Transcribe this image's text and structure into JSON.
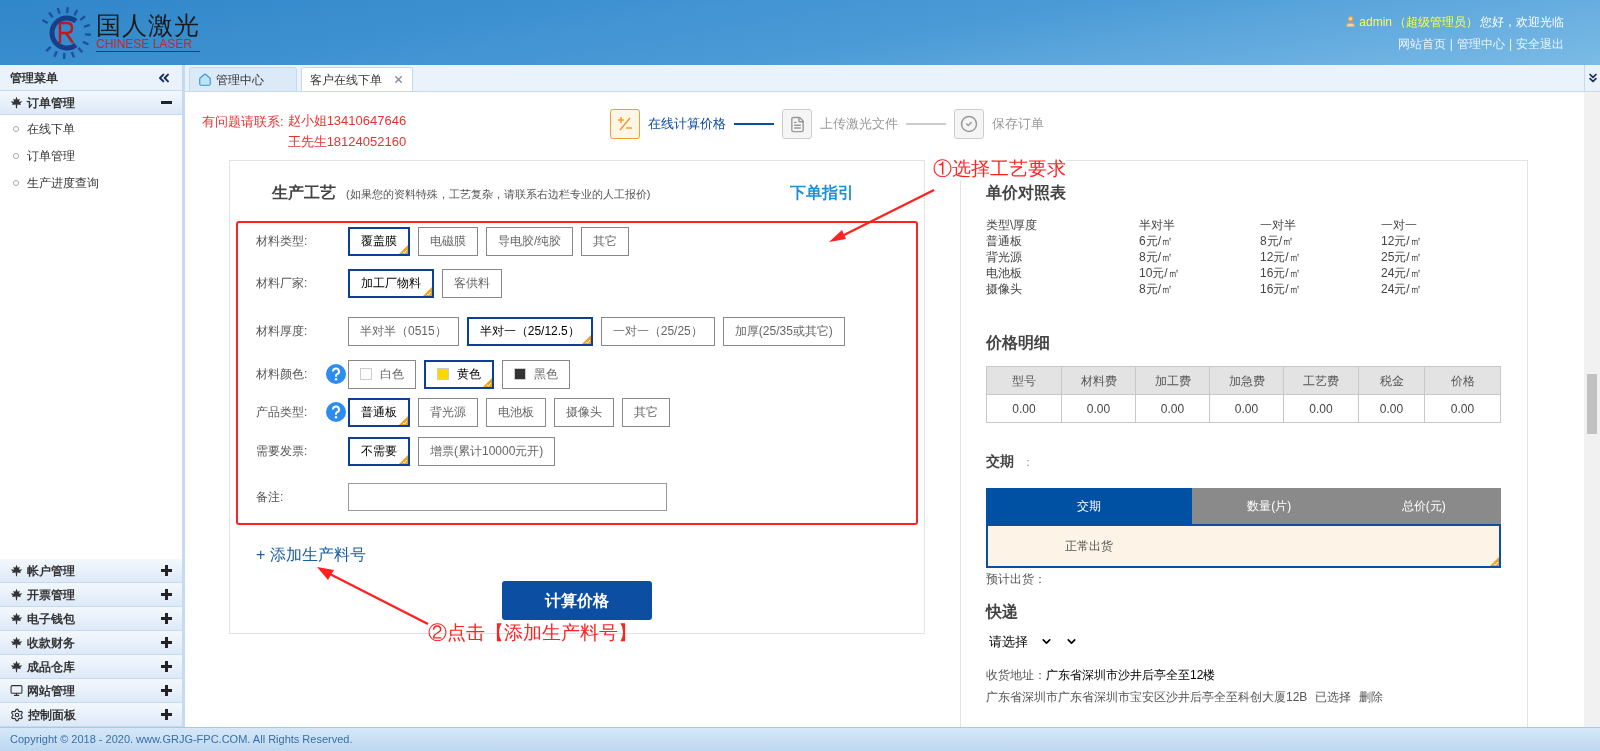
{
  "header": {
    "logo": {
      "name": "国人激光",
      "tagline": "CHINESE LASER"
    },
    "user": {
      "name": "admin",
      "role": "（超级管理员）",
      "greeting": "您好，欢迎光临"
    },
    "links": [
      "网站首页",
      "管理中心",
      "安全退出"
    ],
    "separator": "|"
  },
  "sidebar": {
    "title": "管理菜单",
    "groups": [
      {
        "label": "订单管理",
        "expanded": true,
        "items": [
          "在线下单",
          "订单管理",
          "生产进度查询"
        ]
      },
      {
        "label": "帐户管理",
        "expanded": false
      },
      {
        "label": "开票管理",
        "expanded": false
      },
      {
        "label": "电子钱包",
        "expanded": false
      },
      {
        "label": "收款财务",
        "expanded": false
      },
      {
        "label": "成品仓库",
        "expanded": false
      },
      {
        "label": "网站管理",
        "expanded": false
      },
      {
        "label": "控制面板",
        "expanded": false
      }
    ]
  },
  "tabs": [
    {
      "label": "管理中心",
      "selected": false
    },
    {
      "label": "客户在线下单",
      "selected": true
    }
  ],
  "contact": {
    "label": "有问题请联系:",
    "lines": [
      "赵小姐13410647646",
      "王先生18124052160"
    ]
  },
  "steps": [
    {
      "label": "在线计算价格",
      "active": true
    },
    {
      "label": "上传激光文件",
      "active": false
    },
    {
      "label": "保存订单",
      "active": false
    }
  ],
  "form": {
    "title": "生产工艺",
    "note": "(如果您的资料特殊，工艺复杂，请联系右边栏专业的人工报价)",
    "guide_link": "下单指引",
    "rows": [
      {
        "label": "材料类型:",
        "help": false,
        "options": [
          {
            "label": "覆盖膜",
            "selected": true
          },
          {
            "label": "电磁膜",
            "selected": false
          },
          {
            "label": "导电胶/纯胶",
            "selected": false
          },
          {
            "label": "其它",
            "selected": false
          }
        ]
      },
      {
        "label": "材料厂家:",
        "help": false,
        "options": [
          {
            "label": "加工厂物料",
            "selected": true
          },
          {
            "label": "客供料",
            "selected": false
          }
        ]
      },
      {
        "label": "材料厚度:",
        "help": false,
        "options": [
          {
            "label": "半对半（0515）",
            "selected": false
          },
          {
            "label": "半对一（25/12.5）",
            "selected": true
          },
          {
            "label": "一对一（25/25）",
            "selected": false
          },
          {
            "label": "加厚(25/35或其它)",
            "selected": false
          }
        ]
      },
      {
        "label": "材料颜色:",
        "help": true,
        "options": [
          {
            "label": "白色",
            "selected": false,
            "color": "#ffffff"
          },
          {
            "label": "黄色",
            "selected": true,
            "color": "#ffd700"
          },
          {
            "label": "黑色",
            "selected": false,
            "color": "#333333"
          }
        ]
      },
      {
        "label": "产品类型:",
        "help": true,
        "options": [
          {
            "label": "普通板",
            "selected": true
          },
          {
            "label": "背光源",
            "selected": false
          },
          {
            "label": "电池板",
            "selected": false
          },
          {
            "label": "摄像头",
            "selected": false
          },
          {
            "label": "其它",
            "selected": false
          }
        ]
      },
      {
        "label": "需要发票:",
        "help": false,
        "options": [
          {
            "label": "不需要",
            "selected": true
          },
          {
            "label": "增票(累计10000元开)",
            "selected": false
          }
        ]
      }
    ],
    "remark": {
      "label": "备注:"
    },
    "add_link": "+ 添加生产料号",
    "calc_button": "计算价格"
  },
  "price_table": {
    "title": "单价对照表",
    "columns": [
      "类型\\厚度",
      "半对半",
      "一对半",
      "一对一"
    ],
    "rows": [
      [
        "普通板",
        "6元/㎡",
        "8元/㎡",
        "12元/㎡"
      ],
      [
        "背光源",
        "8元/㎡",
        "12元/㎡",
        "25元/㎡"
      ],
      [
        "电池板",
        "10元/㎡",
        "16元/㎡",
        "24元/㎡"
      ],
      [
        "摄像头",
        "8元/㎡",
        "16元/㎡",
        "24元/㎡"
      ]
    ]
  },
  "price_detail": {
    "title": "价格明细",
    "columns": [
      "型号",
      "材料费",
      "加工费",
      "加急费",
      "工艺费",
      "税金",
      "价格"
    ],
    "values": [
      "0.00",
      "0.00",
      "0.00",
      "0.00",
      "0.00",
      "0.00",
      "0.00"
    ]
  },
  "delivery": {
    "title": "交期",
    "colon": "：",
    "tabs": [
      {
        "label": "交期",
        "selected": true
      },
      {
        "label": "数量(片)",
        "selected": false
      },
      {
        "label": "总价(元)",
        "selected": false
      }
    ],
    "option": {
      "label": "正常出货",
      "selected": true
    },
    "estimate": "预计出货："
  },
  "express": {
    "title": "快递",
    "select": "请选择"
  },
  "address": {
    "label": "收货地址：",
    "value": "广东省深圳市沙井后亭全至12楼",
    "entry": "广东省深圳市广东省深圳市宝安区沙井后亭全至科创大厦12B",
    "status": "已选择",
    "action": "删除"
  },
  "annotations": [
    "①选择工艺要求",
    "②点击【添加生产料号】"
  ],
  "footer": "Copyright © 2018 - 2020. www.GRJG-FPC.COM. All Rights Reserved."
}
